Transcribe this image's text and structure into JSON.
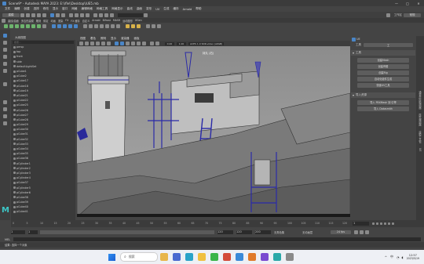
{
  "window": {
    "title": "Scene9* - Autodesk MAYA 2023: E:\\\\fle\\\\Desktop\\\\UE5.mb",
    "controls": [
      "—",
      "□",
      "✕"
    ]
  },
  "menubar": {
    "items": [
      "文件",
      "编辑",
      "创建",
      "选择",
      "修改",
      "显示",
      "窗口",
      "网格",
      "编辑网格",
      "网格工具",
      "网格显示",
      "曲线",
      "曲面",
      "变形",
      "UV",
      "生成",
      "缓存",
      "Arnold",
      "帮助"
    ]
  },
  "status_line": {
    "mode": "建模",
    "field": "",
    "workspace_label": "工作区",
    "workspace_value": "常规"
  },
  "shelf": {
    "tabs": [
      "曲线/曲面",
      "多边形建模",
      "雕刻",
      "绑定",
      "动画",
      "渲染",
      "FX",
      "FX 缓存",
      "自定义",
      "Arnold",
      "Bifrost",
      "MASH",
      "运动图形",
      "XGen"
    ]
  },
  "viewport": {
    "menu": [
      "视图",
      "着色",
      "照明",
      "显示",
      "渲染器",
      "面板"
    ],
    "camera_label": "持久 (右) ",
    "hud_label": "ACES 1.0 SDR-video (sRGB)",
    "gamma": "0.00",
    "exposure": "1.00"
  },
  "outliner": {
    "title": "大纲视图",
    "search_placeholder": "搜索...",
    "items": [
      "persp",
      "top",
      "front",
      "side",
      "defaultLightSet",
      "pCube1",
      "pCube2",
      "pCube17",
      "pCube18",
      "pCube19",
      "pCube21",
      "pCube22",
      "pCube25",
      "pCube26",
      "pCube27",
      "pCube28",
      "pCube29",
      "pCube30",
      "pCube31",
      "pCube32",
      "pCube33",
      "pCube34",
      "pCube35",
      "pCube36",
      "pCylinder1",
      "pCylinder2",
      "pCylinder3",
      "pCylinder4",
      "pCube37",
      "pCylinder5",
      "pCylinder6",
      "pCube38",
      "pCube39",
      "pCube40",
      "pCube41"
    ]
  },
  "right_panel": {
    "title": "UE",
    "dropdown_label": "工具",
    "dropdown_value": "工",
    "section1": "工具",
    "buttons": [
      "创建Mesh",
      "创建骨骼",
      "创建Rig",
      "自动化组件生成",
      "快速UV工具"
    ],
    "section2": "导入资源",
    "buttons2": [
      "导入 FBXMesh 到 引擎",
      "导入 Datasmith"
    ]
  },
  "side_tabs": [
    "通道盒/层编辑器",
    "属性编辑器",
    "建模工具包",
    "UE"
  ],
  "timeline": {
    "ticks": [
      "0",
      "5",
      "10",
      "15",
      "20",
      "25",
      "30",
      "35",
      "40",
      "45",
      "50",
      "55",
      "60",
      "65",
      "70",
      "75",
      "80",
      "85",
      "90",
      "95",
      "100",
      "105",
      "110",
      "115",
      "120"
    ],
    "current_frame": "1"
  },
  "range_bar": {
    "start": "1",
    "inner_start": "1",
    "inner_end": "120",
    "end_a": "120",
    "end_b": "200",
    "anim_layer": "无角色集",
    "char_set": "无动画层",
    "fps": "24 fps"
  },
  "command_line": {
    "lang": "MEL",
    "help": "结果: 选择一个对象"
  },
  "taskbar": {
    "search_placeholder": "搜索",
    "time": "12:57",
    "date": "2023/5/19",
    "lang": "中",
    "flag_icon": "windows-icon"
  },
  "colors": {
    "app_bg": "#444444",
    "viewport_sky": "#8d8d8d",
    "accent": "#4a86c8",
    "button": "#5d5d5d",
    "taskbar": "#eef0f5"
  }
}
